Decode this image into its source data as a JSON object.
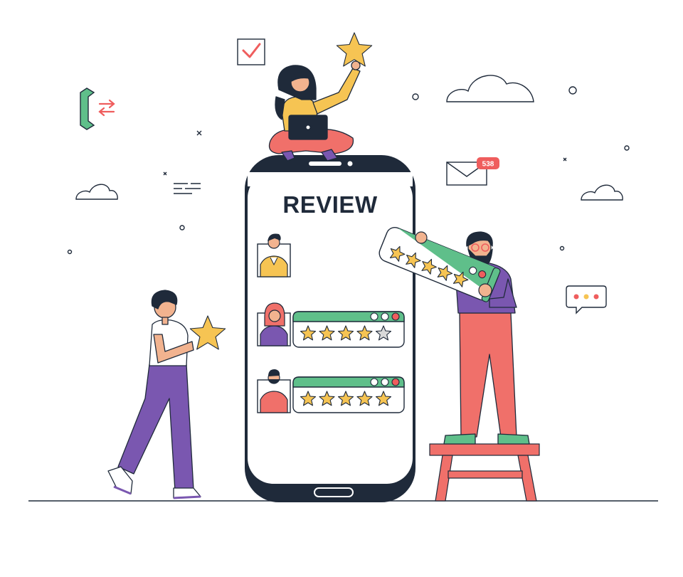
{
  "phone": {
    "title": "REVIEW"
  },
  "mail": {
    "badge_count": "538"
  },
  "reviews": [
    {
      "rating": 4,
      "max": 5
    },
    {
      "rating": 5,
      "max": 5
    }
  ],
  "held_rating_bar": {
    "rating": 5,
    "max": 5
  },
  "colors": {
    "outline": "#1f2a3a",
    "star": "#f6c453",
    "green": "#5fbf8a",
    "red": "#ef5d5d",
    "purple": "#7a57b0",
    "coral": "#f0706a",
    "yellow": "#f6c453",
    "skin": "#f2b38f",
    "hair": "#1f2a3a"
  },
  "icons": [
    "checkbox-icon",
    "phone-call-icon",
    "mail-icon",
    "chat-bubble-icon",
    "cloud-icon",
    "star-icon"
  ]
}
